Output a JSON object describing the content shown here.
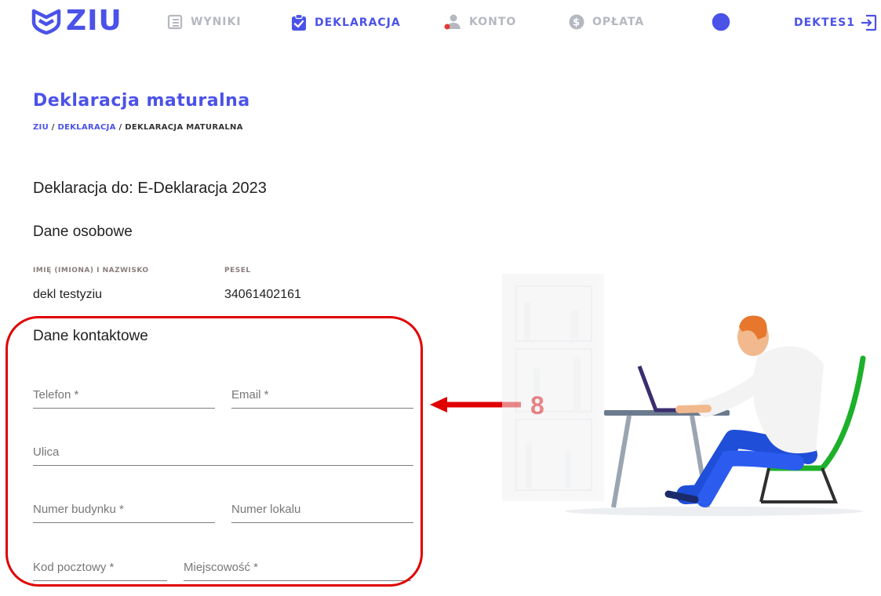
{
  "nav": {
    "logo": "ZIU",
    "items": [
      {
        "label": "WYNIKI",
        "icon": "results-list-icon"
      },
      {
        "label": "DEKLARACJA",
        "icon": "clipboard-check-icon"
      },
      {
        "label": "KONTO",
        "icon": "user-icon"
      },
      {
        "label": "OPŁATA",
        "icon": "dollar-coin-icon"
      }
    ],
    "contrast_icon": "contrast-icon",
    "user": "DEKTES1",
    "logout_icon": "logout-icon"
  },
  "page": {
    "title": "Deklaracja maturalna",
    "breadcrumb": {
      "root": "ZIU",
      "sep1": " / ",
      "link": "DEKLARACJA",
      "sep2": " / ",
      "current": "DEKLARACJA MATURALNA"
    },
    "declaration_to": "Deklaracja do: E-Deklaracja 2023"
  },
  "personal": {
    "heading": "Dane osobowe",
    "name_label": "IMIĘ (IMIONA) I NAZWISKO",
    "name_value": "dekl testyziu",
    "pesel_label": "PESEL",
    "pesel_value": "34061402161"
  },
  "contact": {
    "heading": "Dane kontaktowe",
    "phone": "Telefon *",
    "email": "Email *",
    "street": "Ulica",
    "building": "Numer budynku *",
    "apartment": "Numer lokalu",
    "postal": "Kod pocztowy *",
    "city": "Miejscowość *"
  },
  "annotation": {
    "number": "8",
    "color": "#e00000"
  },
  "colors": {
    "accent": "#4b52e8",
    "muted": "#b5b8c0"
  }
}
